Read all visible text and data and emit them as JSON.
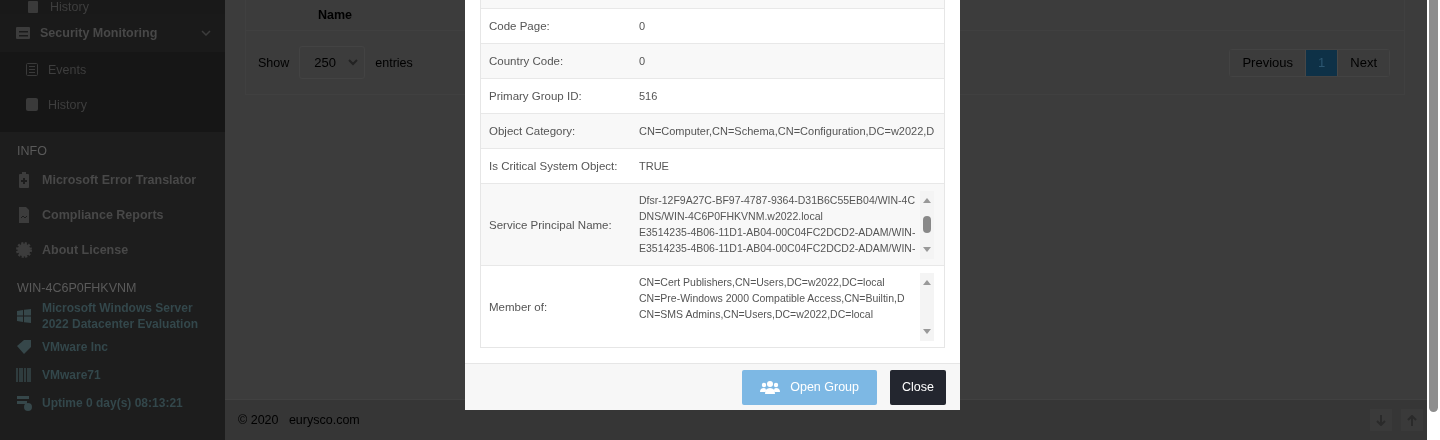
{
  "sidebar": {
    "top_item": {
      "label": "History"
    },
    "group": {
      "label": "Security Monitoring",
      "expanded": true,
      "children": [
        {
          "label": "Events"
        },
        {
          "label": "History"
        }
      ]
    },
    "sections": [
      {
        "heading": "INFO",
        "items": [
          {
            "label": "Microsoft Error Translator"
          },
          {
            "label": "Compliance Reports"
          },
          {
            "label": "About License"
          }
        ]
      },
      {
        "heading": "WIN-4C6P0FHKVNM",
        "items": [
          {
            "label": "Microsoft  Windows  Server  2022  Datacenter  Evaluation"
          },
          {
            "label": "VMware Inc"
          },
          {
            "label": "VMware71"
          },
          {
            "label": "Uptime 0 day(s) 08:13:21"
          }
        ]
      }
    ]
  },
  "table": {
    "columns": [
      "Name"
    ],
    "show_label": "Show",
    "entries_select": "250",
    "entries_label": "entries",
    "pagination": [
      {
        "label": "Previous",
        "selected": false
      },
      {
        "label": "1",
        "selected": true
      },
      {
        "label": "Next",
        "selected": false
      }
    ]
  },
  "footer": {
    "text": "© 2020   eurysco.com"
  },
  "modal": {
    "properties": [
      {
        "kind": "text",
        "label": "Code Page:",
        "value": "0"
      },
      {
        "kind": "text",
        "label": "Country Code:",
        "value": "0"
      },
      {
        "kind": "text",
        "label": "Primary Group ID:",
        "value": "516"
      },
      {
        "kind": "text",
        "label": "Object Category:",
        "value": "CN=Computer,CN=Schema,CN=Configuration,DC=w2022,D"
      },
      {
        "kind": "text",
        "label": "Is Critical System Object:",
        "value": "TRUE"
      },
      {
        "kind": "list",
        "label": "Service Principal Name:",
        "lines": [
          "Dfsr-12F9A27C-BF97-4787-9364-D31B6C55EB04/WIN-4C",
          "DNS/WIN-4C6P0FHKVNM.w2022.local",
          "E3514235-4B06-11D1-AB04-00C04FC2DCD2-ADAM/WIN-",
          "E3514235-4B06-11D1-AB04-00C04FC2DCD2-ADAM/WIN-"
        ]
      },
      {
        "kind": "list",
        "label": "Member of:",
        "lines": [
          "CN=Cert Publishers,CN=Users,DC=w2022,DC=local",
          "CN=Pre-Windows 2000 Compatible Access,CN=Builtin,D",
          "CN=SMS Admins,CN=Users,DC=w2022,DC=local"
        ]
      }
    ],
    "buttons": [
      {
        "kind": "primary",
        "label": "Open Group"
      },
      {
        "kind": "dark",
        "label": "Close"
      }
    ]
  }
}
